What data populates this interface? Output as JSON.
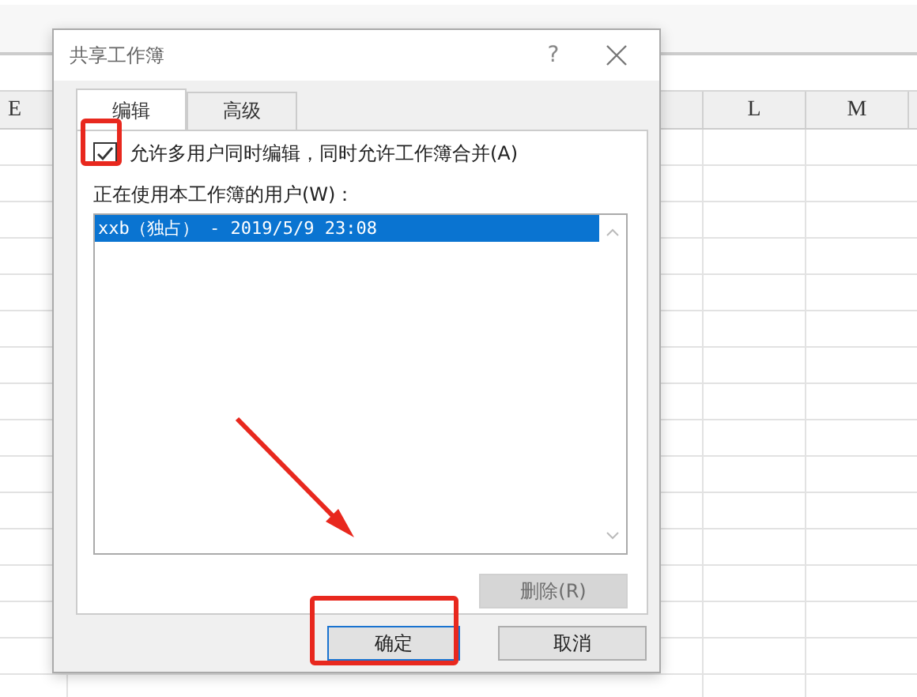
{
  "spreadsheet": {
    "columns": [
      {
        "label": "E",
        "kind": "wide"
      },
      {
        "kind": "hidden"
      },
      {
        "label": "L",
        "kind": "normal"
      },
      {
        "label": "M",
        "kind": "normal"
      }
    ]
  },
  "dialog": {
    "title": "共享工作簿",
    "help": "?",
    "tabs": [
      {
        "label": "编辑",
        "selected": true
      },
      {
        "label": "高级",
        "selected": false
      }
    ],
    "allow_multi": {
      "label": "允许多用户同时编辑，同时允许工作簿合并(A)",
      "checked": true
    },
    "users_label": "正在使用本工作簿的用户(W)：",
    "users": [
      {
        "text": "xxb（独占） - 2019/5/9 23:08",
        "selected": true
      }
    ],
    "remove_button": {
      "label": "删除(R)",
      "disabled": true
    },
    "buttons": [
      {
        "label": "确定",
        "focused": true
      },
      {
        "label": "取消",
        "focused": false
      }
    ]
  }
}
